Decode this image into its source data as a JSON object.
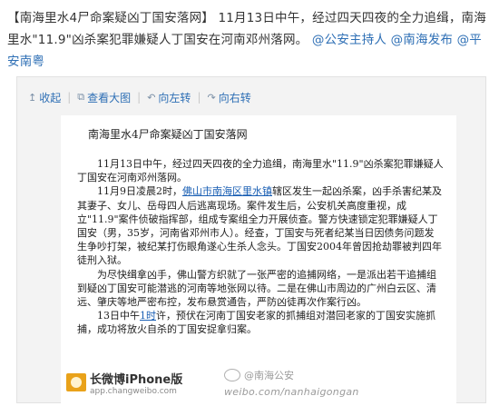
{
  "post": {
    "lead": "【南海里水4尸命案疑凶丁国安落网】 11月13日中午，经过四天四夜的全力追缉，南海里水\"11.9\"凶杀案犯罪嫌疑人丁国安在河南邓州落网。",
    "mentions": [
      "@公安主持人",
      "@南海发布",
      "@平安南粤"
    ]
  },
  "toolbar": {
    "collapse": "收起",
    "view_large": "查看大图",
    "rotate_left": "向左转",
    "rotate_right": "向右转"
  },
  "article": {
    "title": "南海里水4尸命案疑凶丁国安落网",
    "p1": "11月13日中午，经过四天四夜的全力追缉，南海里水\"11.9\"凶杀案犯罪嫌疑人丁国安在河南邓州落网。",
    "p2_pre": "11月9日凌晨2时，",
    "p2_link": "佛山市南海区里水镇",
    "p2_post": "辖区发生一起凶杀案，凶手杀害纪某及其妻子、女儿、岳母四人后逃离现场。案件发生后，公安机关高度重视，成立\"11.9\"案件侦破指挥部，组成专案组全力开展侦查。警方快速锁定犯罪嫌疑人丁国安（男，35岁，河南省邓州市人）。经查，丁国安与死者纪某当日因债务问题发生争吵打架，被纪某打伤眼角遂心生杀人念头。丁国安2004年曾因抢劫罪被判四年徒刑入狱。",
    "p3": "为尽快缉拿凶手，佛山警方织就了一张严密的追捕网络，一是派出若干追捕组到疑凶丁国安可能潜逃的河南等地张网以待。二是在佛山市周边的广州白云区、清远、肇庆等地严密布控，发布悬赏通告，严防凶徒再次作案行凶。",
    "p4_pre": "13日中午",
    "p4_link": "1时",
    "p4_post": "许，预伏在河南丁国安老家的抓捕组对潜回老家的丁国安实施抓捕，成功将放火自杀的丁国安捉拿归案。"
  },
  "footer": {
    "app_name": "长微博iPhone版",
    "app_url": "app.changweibo.com",
    "watermark_handle": "@南海公安",
    "watermark_domain": "weibo.com/nanhaigongan"
  }
}
